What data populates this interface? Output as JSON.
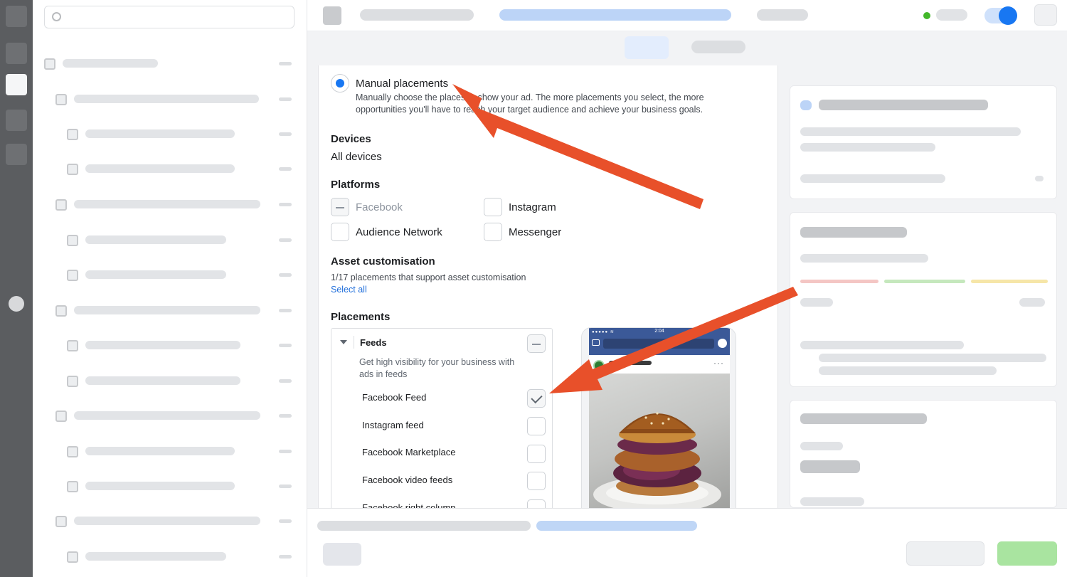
{
  "placement": {
    "manual_title": "Manual placements",
    "manual_desc": "Manually choose the places to show your ad. The more placements you select, the more opportunities you'll have to reach your target audience and achieve your business goals."
  },
  "devices": {
    "title": "Devices",
    "value": "All devices"
  },
  "platforms": {
    "title": "Platforms",
    "items": [
      {
        "label": "Facebook",
        "state": "mixed"
      },
      {
        "label": "Instagram",
        "state": "unchecked"
      },
      {
        "label": "Audience Network",
        "state": "unchecked"
      },
      {
        "label": "Messenger",
        "state": "unchecked"
      }
    ]
  },
  "asset": {
    "title": "Asset customisation",
    "desc": "1/17 placements that support asset customisation",
    "select_all": "Select all"
  },
  "placements": {
    "title": "Placements",
    "group": {
      "title": "Feeds",
      "desc": "Get high visibility for your business with ads in feeds",
      "state": "mixed"
    },
    "items": [
      {
        "label": "Facebook Feed",
        "checked": true
      },
      {
        "label": "Instagram feed",
        "checked": false
      },
      {
        "label": "Facebook Marketplace",
        "checked": false
      },
      {
        "label": "Facebook video feeds",
        "checked": false
      },
      {
        "label": "Facebook right column",
        "checked": false
      }
    ]
  },
  "preview": {
    "time": "2:04",
    "signal": "●●●●● ≋"
  },
  "colors": {
    "accent": "#1877f2",
    "arrow": "#e8502a",
    "link": "#216fdb",
    "publish": "#a9e4a0"
  },
  "icons": [
    "search-icon",
    "menu-icon",
    "chart-icon",
    "pencil-icon",
    "grid-icon",
    "search-icon",
    "caret-down-icon",
    "camera-icon",
    "messenger-icon"
  ]
}
